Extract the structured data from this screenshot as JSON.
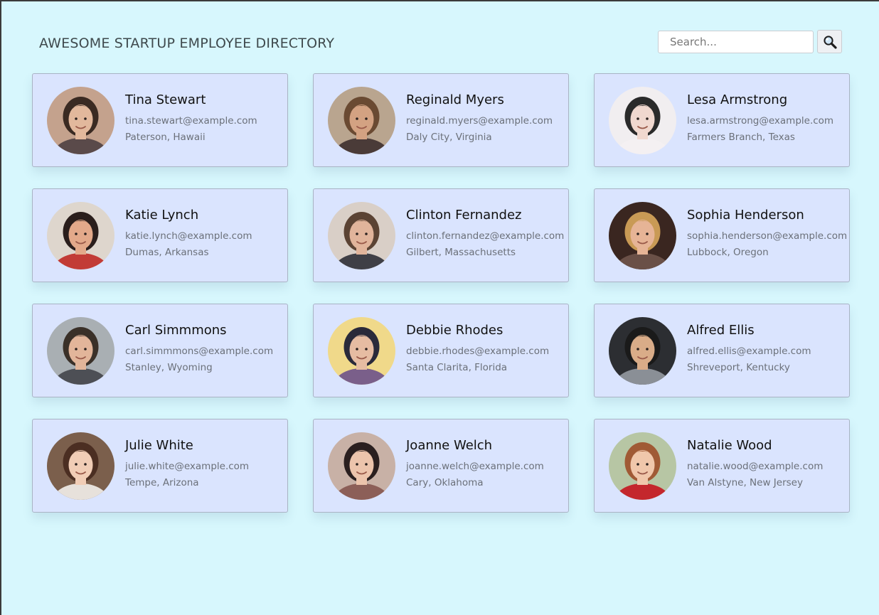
{
  "header": {
    "title": "AWESOME STARTUP EMPLOYEE DIRECTORY"
  },
  "search": {
    "placeholder": "Search...",
    "value": "",
    "button_icon": "magnifier-icon"
  },
  "employees": [
    {
      "name": "Tina Stewart",
      "email": "tina.stewart@example.com",
      "location": "Paterson, Hawaii",
      "avatar": {
        "bg": "#c4a28d",
        "hair": "#3a2a22",
        "skin": "#e2b89c",
        "shirt": "#5a4a4a"
      }
    },
    {
      "name": "Reginald Myers",
      "email": "reginald.myers@example.com",
      "location": "Daly City, Virginia",
      "avatar": {
        "bg": "#b9a58f",
        "hair": "#6a4a32",
        "skin": "#d3a282",
        "shirt": "#4a3b38"
      }
    },
    {
      "name": "Lesa Armstrong",
      "email": "lesa.armstrong@example.com",
      "location": "Farmers Branch, Texas",
      "avatar": {
        "bg": "#f1eef0",
        "hair": "#2a2a2a",
        "skin": "#f0d8cf",
        "shirt": "#f4f0f2"
      }
    },
    {
      "name": "Katie Lynch",
      "email": "katie.lynch@example.com",
      "location": "Dumas, Arkansas",
      "avatar": {
        "bg": "#ded6cd",
        "hair": "#2a1e1c",
        "skin": "#e3a98a",
        "shirt": "#c23b36"
      }
    },
    {
      "name": "Clinton Fernandez",
      "email": "clinton.fernandez@example.com",
      "location": "Gilbert, Massachusetts",
      "avatar": {
        "bg": "#d9cfc7",
        "hair": "#5b4334",
        "skin": "#e1b49b",
        "shirt": "#3f3f46"
      }
    },
    {
      "name": "Sophia Henderson",
      "email": "sophia.henderson@example.com",
      "location": "Lubbock, Oregon",
      "avatar": {
        "bg": "#3a2620",
        "hair": "#c99a55",
        "skin": "#e6b496",
        "shirt": "#6a5047"
      }
    },
    {
      "name": "Carl Simmmons",
      "email": "carl.simmmons@example.com",
      "location": "Stanley, Wyoming",
      "avatar": {
        "bg": "#a9afb3",
        "hair": "#3a3028",
        "skin": "#e2b59a",
        "shirt": "#4d4f55"
      }
    },
    {
      "name": "Debbie Rhodes",
      "email": "debbie.rhodes@example.com",
      "location": "Santa Clarita, Florida",
      "avatar": {
        "bg": "#f0d98a",
        "hair": "#2a2a3a",
        "skin": "#e6bca2",
        "shirt": "#7a5f8a"
      }
    },
    {
      "name": "Alfred Ellis",
      "email": "alfred.ellis@example.com",
      "location": "Shreveport, Kentucky",
      "avatar": {
        "bg": "#2c2e32",
        "hair": "#1a1a1a",
        "skin": "#d9ac88",
        "shirt": "#8a8f96"
      }
    },
    {
      "name": "Julie White",
      "email": "julie.white@example.com",
      "location": "Tempe, Arizona",
      "avatar": {
        "bg": "#7b5f4c",
        "hair": "#4b2e22",
        "skin": "#f1cdb6",
        "shirt": "#e7e1db"
      }
    },
    {
      "name": "Joanne Welch",
      "email": "joanne.welch@example.com",
      "location": "Cary, Oklahoma",
      "avatar": {
        "bg": "#c8b1a6",
        "hair": "#2a1f1f",
        "skin": "#ecc4ac",
        "shirt": "#8c5f58"
      }
    },
    {
      "name": "Natalie Wood",
      "email": "natalie.wood@example.com",
      "location": "Van Alstyne, New Jersey",
      "avatar": {
        "bg": "#b7c6a4",
        "hair": "#a05a35",
        "skin": "#f0c7ab",
        "shirt": "#c4272d"
      }
    }
  ]
}
